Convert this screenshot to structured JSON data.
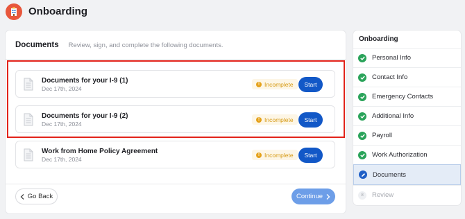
{
  "app": {
    "title": "Onboarding",
    "logo_icon": "building-badge-icon"
  },
  "documents": {
    "title": "Documents",
    "subtitle": "Review, sign, and complete the following documents.",
    "items": [
      {
        "name": "Documents for your I-9 (1)",
        "date": "Dec 17th, 2024",
        "status": "Incomplete",
        "action": "Start"
      },
      {
        "name": "Documents for your I-9 (2)",
        "date": "Dec 17th, 2024",
        "status": "Incomplete",
        "action": "Start"
      },
      {
        "name": "Work from Home Policy Agreement",
        "date": "Dec 17th, 2024",
        "status": "Incomplete",
        "action": "Start"
      }
    ],
    "back_label": "Go Back",
    "continue_label": "Continue",
    "status_dot": "!"
  },
  "steps": {
    "title": "Onboarding",
    "items": [
      {
        "label": "Personal Info",
        "state": "done"
      },
      {
        "label": "Contact Info",
        "state": "done"
      },
      {
        "label": "Emergency Contacts",
        "state": "done"
      },
      {
        "label": "Additional Info",
        "state": "done"
      },
      {
        "label": "Payroll",
        "state": "done"
      },
      {
        "label": "Work Authorization",
        "state": "done"
      },
      {
        "label": "Documents",
        "state": "current"
      },
      {
        "label": "Review",
        "state": "pending",
        "number": "8"
      }
    ]
  },
  "colors": {
    "primary": "#1258c7",
    "continue_disabled": "#6d9ee8",
    "success": "#2aa35a",
    "warning": "#e5a21b",
    "highlight": "#e2231a",
    "logo": "#e8573c"
  }
}
